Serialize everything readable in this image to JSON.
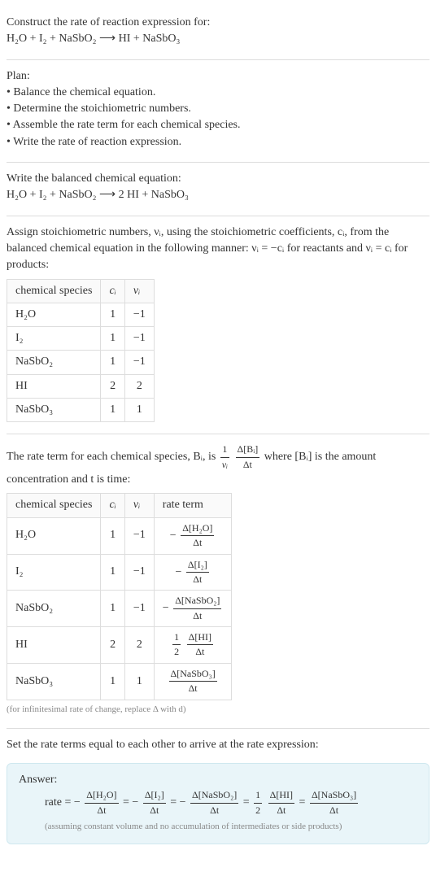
{
  "intro": {
    "heading": "Construct the rate of reaction expression for:",
    "equation": "H₂O + I₂ + NaSbO₂ ⟶ HI + NaSbO₃"
  },
  "plan": {
    "heading": "Plan:",
    "items": [
      "• Balance the chemical equation.",
      "• Determine the stoichiometric numbers.",
      "• Assemble the rate term for each chemical species.",
      "• Write the rate of reaction expression."
    ]
  },
  "balanced": {
    "heading": "Write the balanced chemical equation:",
    "equation": "H₂O + I₂ + NaSbO₂ ⟶ 2 HI + NaSbO₃"
  },
  "stoich": {
    "heading": "Assign stoichiometric numbers, νᵢ, using the stoichiometric coefficients, cᵢ, from the balanced chemical equation in the following manner: νᵢ = −cᵢ for reactants and νᵢ = cᵢ for products:",
    "headers": {
      "species": "chemical species",
      "c": "cᵢ",
      "v": "νᵢ"
    },
    "rows": [
      {
        "species": "H₂O",
        "c": "1",
        "v": "−1"
      },
      {
        "species": "I₂",
        "c": "1",
        "v": "−1"
      },
      {
        "species": "NaSbO₂",
        "c": "1",
        "v": "−1"
      },
      {
        "species": "HI",
        "c": "2",
        "v": "2"
      },
      {
        "species": "NaSbO₃",
        "c": "1",
        "v": "1"
      }
    ]
  },
  "rateterm": {
    "pre": "The rate term for each chemical species, Bᵢ, is ",
    "frac1_num": "1",
    "frac1_den": "νᵢ",
    "frac2_num": "Δ[Bᵢ]",
    "frac2_den": "Δt",
    "post": " where [Bᵢ] is the amount concentration and t is time:",
    "headers": {
      "species": "chemical species",
      "c": "cᵢ",
      "v": "νᵢ",
      "rate": "rate term"
    },
    "rows": [
      {
        "species": "H₂O",
        "c": "1",
        "v": "−1",
        "sign": "−",
        "coef": "",
        "num": "Δ[H₂O]",
        "den": "Δt"
      },
      {
        "species": "I₂",
        "c": "1",
        "v": "−1",
        "sign": "−",
        "coef": "",
        "num": "Δ[I₂]",
        "den": "Δt"
      },
      {
        "species": "NaSbO₂",
        "c": "1",
        "v": "−1",
        "sign": "−",
        "coef": "",
        "num": "Δ[NaSbO₂]",
        "den": "Δt"
      },
      {
        "species": "HI",
        "c": "2",
        "v": "2",
        "sign": "",
        "coef": "1/2",
        "num": "Δ[HI]",
        "den": "Δt"
      },
      {
        "species": "NaSbO₃",
        "c": "1",
        "v": "1",
        "sign": "",
        "coef": "",
        "num": "Δ[NaSbO₃]",
        "den": "Δt"
      }
    ],
    "note": "(for infinitesimal rate of change, replace Δ with d)"
  },
  "final": {
    "heading": "Set the rate terms equal to each other to arrive at the rate expression:"
  },
  "answer": {
    "label": "Answer:",
    "line_prefix": "rate = ",
    "terms": [
      {
        "sign": "−",
        "coef": "",
        "num": "Δ[H₂O]",
        "den": "Δt"
      },
      {
        "sign": "−",
        "coef": "",
        "num": "Δ[I₂]",
        "den": "Δt"
      },
      {
        "sign": "−",
        "coef": "",
        "num": "Δ[NaSbO₂]",
        "den": "Δt"
      },
      {
        "sign": "",
        "coef": "1/2",
        "num": "Δ[HI]",
        "den": "Δt"
      },
      {
        "sign": "",
        "coef": "",
        "num": "Δ[NaSbO₃]",
        "den": "Δt"
      }
    ],
    "note": "(assuming constant volume and no accumulation of intermediates or side products)"
  },
  "chart_data": {
    "type": "table",
    "tables": [
      {
        "title": "Stoichiometric numbers",
        "columns": [
          "chemical species",
          "cᵢ",
          "νᵢ"
        ],
        "rows": [
          [
            "H₂O",
            1,
            -1
          ],
          [
            "I₂",
            1,
            -1
          ],
          [
            "NaSbO₂",
            1,
            -1
          ],
          [
            "HI",
            2,
            2
          ],
          [
            "NaSbO₃",
            1,
            1
          ]
        ]
      },
      {
        "title": "Rate terms",
        "columns": [
          "chemical species",
          "cᵢ",
          "νᵢ",
          "rate term"
        ],
        "rows": [
          [
            "H₂O",
            1,
            -1,
            "−Δ[H₂O]/Δt"
          ],
          [
            "I₂",
            1,
            -1,
            "−Δ[I₂]/Δt"
          ],
          [
            "NaSbO₂",
            1,
            -1,
            "−Δ[NaSbO₂]/Δt"
          ],
          [
            "HI",
            2,
            2,
            "(1/2) Δ[HI]/Δt"
          ],
          [
            "NaSbO₃",
            1,
            1,
            "Δ[NaSbO₃]/Δt"
          ]
        ]
      }
    ]
  }
}
